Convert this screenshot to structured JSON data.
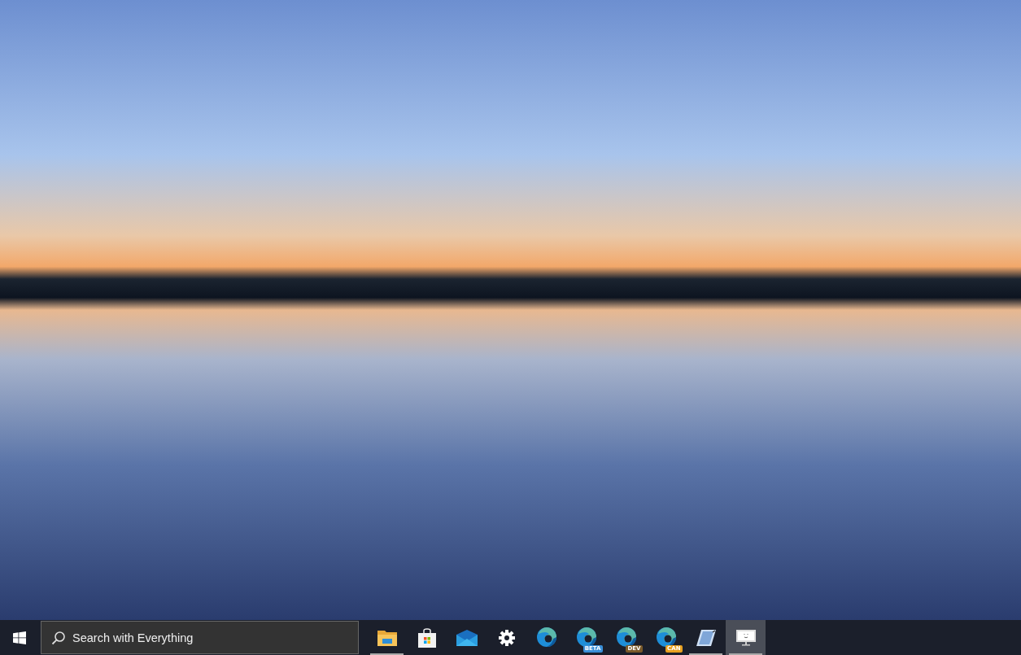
{
  "taskbar": {
    "search": {
      "placeholder": "Search with Everything"
    },
    "apps": [
      {
        "kind": "folder",
        "running": true,
        "selected": false
      },
      {
        "kind": "store",
        "running": false,
        "selected": false
      },
      {
        "kind": "mail",
        "running": false,
        "selected": false
      },
      {
        "kind": "gear",
        "running": false,
        "selected": false
      },
      {
        "kind": "edge",
        "running": false,
        "selected": false
      },
      {
        "kind": "edge",
        "badge": "BETA",
        "color": "#3a8fd8",
        "running": false,
        "selected": false
      },
      {
        "kind": "edge",
        "badge": "DEV",
        "color": "#7a5a2a",
        "running": false,
        "selected": false
      },
      {
        "kind": "edge",
        "badge": "CAN",
        "color": "#e8a020",
        "running": false,
        "selected": false
      },
      {
        "kind": "notepad",
        "running": true,
        "selected": false
      },
      {
        "kind": "monitor",
        "running": true,
        "selected": true
      }
    ]
  }
}
